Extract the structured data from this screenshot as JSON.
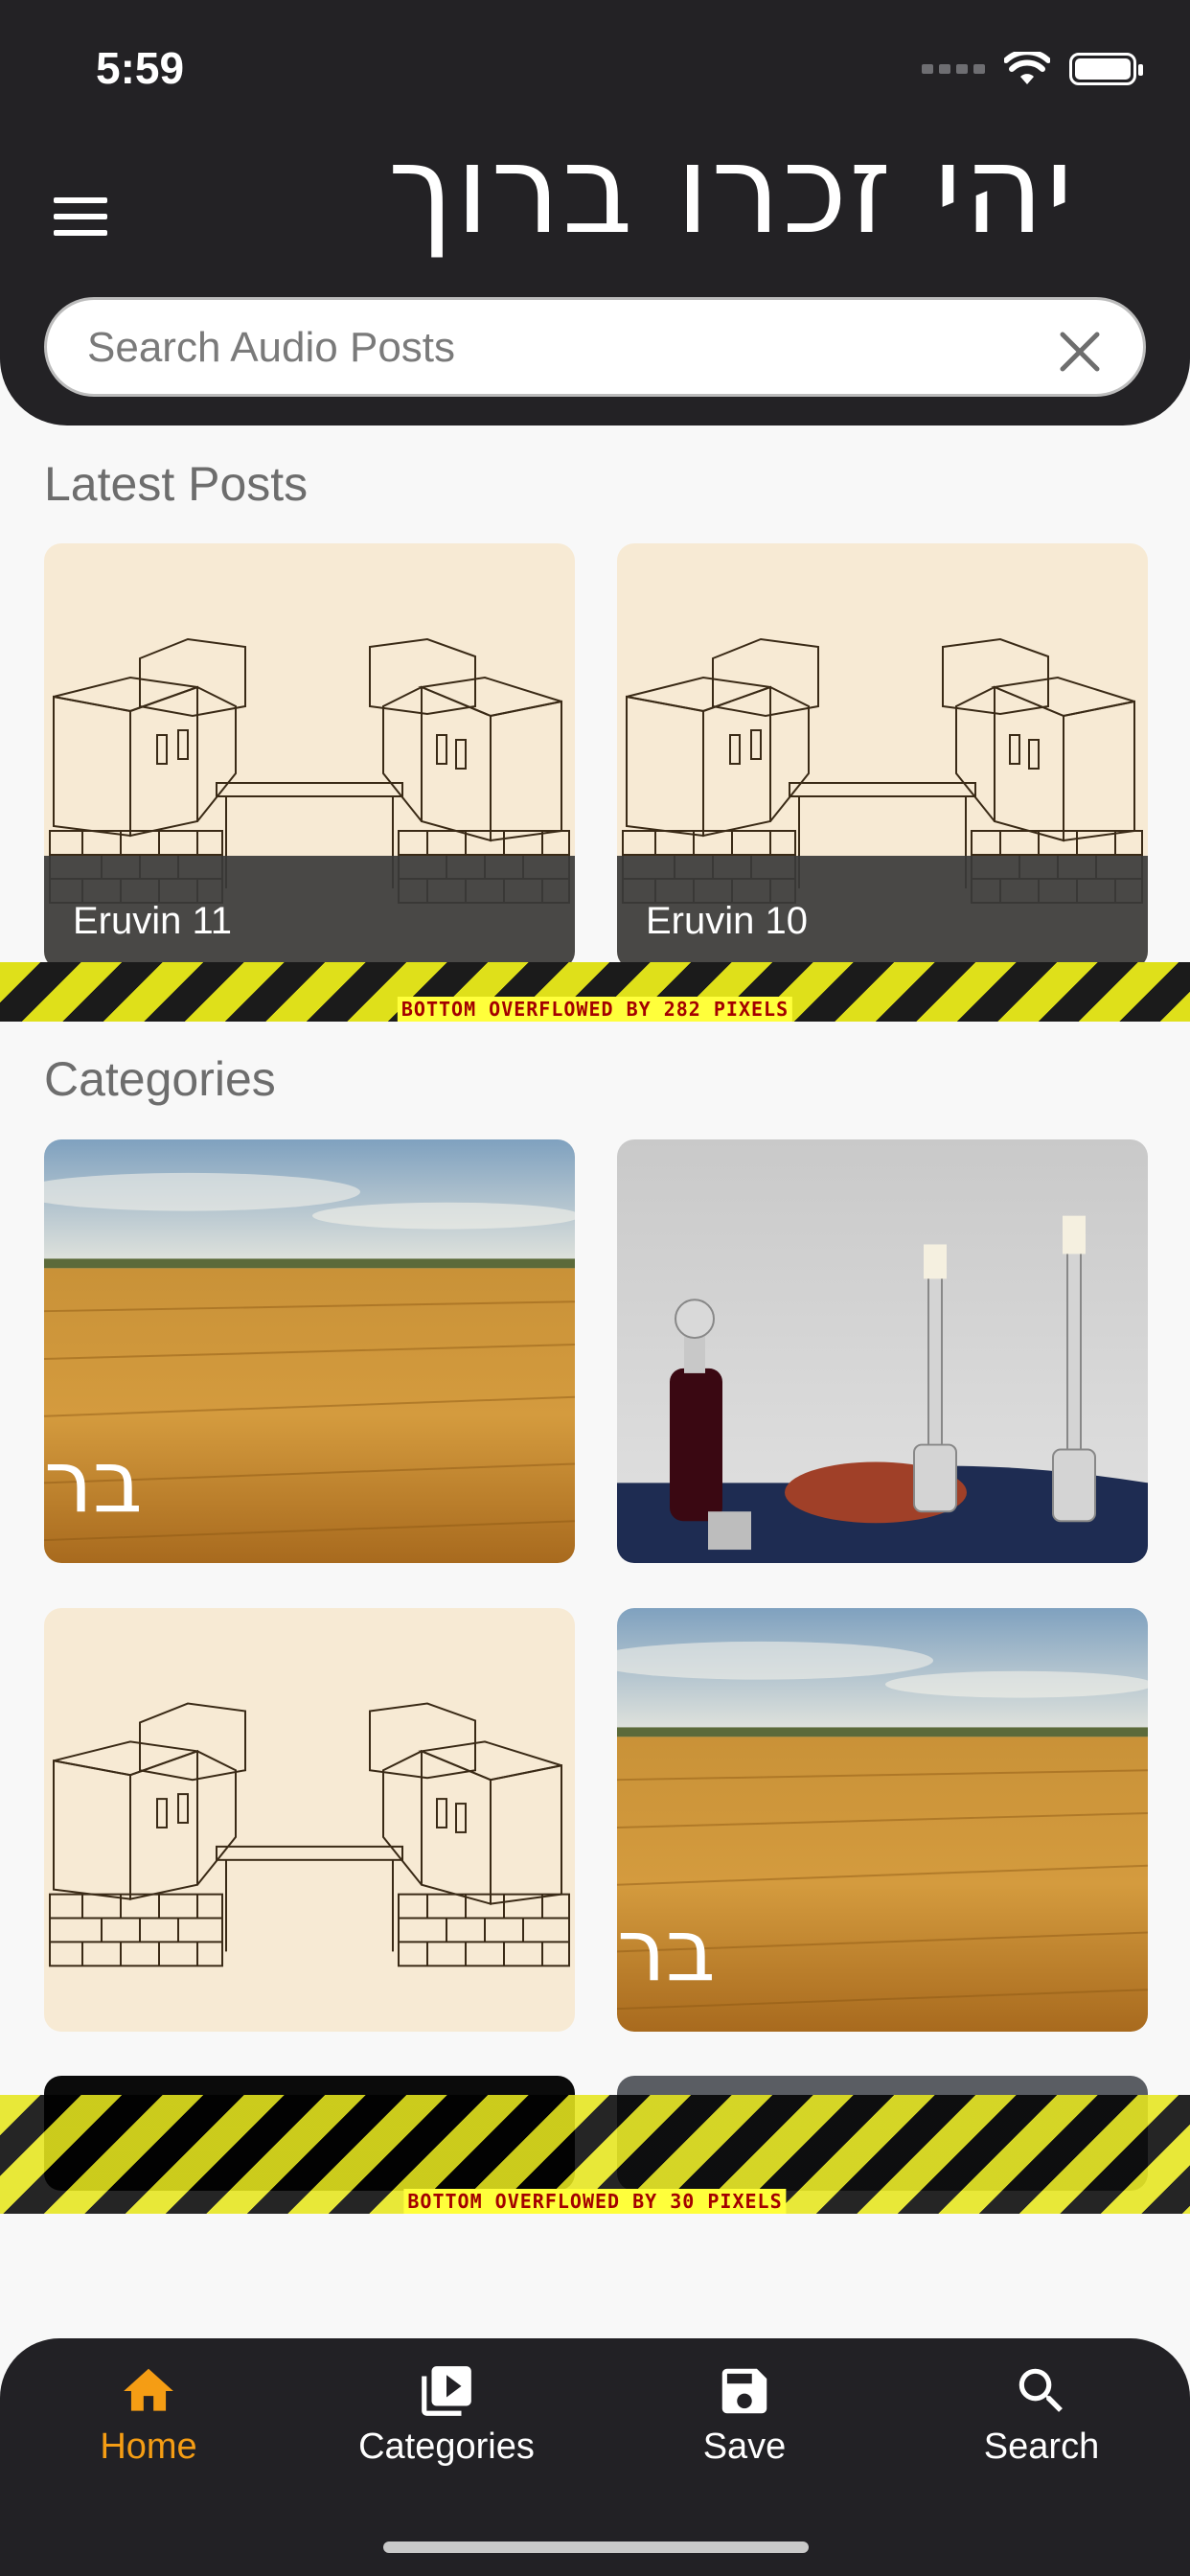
{
  "status_bar": {
    "time": "5:59"
  },
  "header": {
    "title": "יהי זכרו ברוך",
    "menu_icon": "hamburger-icon",
    "search": {
      "placeholder": "Search Audio Posts",
      "value": "",
      "clear_icon": "close-icon"
    }
  },
  "latest": {
    "heading": "Latest Posts",
    "posts": [
      {
        "title": "Eruvin 11",
        "image": "eruvin-illustration"
      },
      {
        "title": "Eruvin 10",
        "image": "eruvin-illustration"
      }
    ]
  },
  "overflow_warnings": [
    "BOTTOM OVERFLOWED BY 282 PIXELS",
    "BOTTOM OVERFLOWED BY 30 PIXELS"
  ],
  "categories": {
    "heading": "Categories",
    "items": [
      {
        "image": "wheat-field",
        "overlay_text": "בר"
      },
      {
        "image": "shabbat-candles"
      },
      {
        "image": "eruvin-illustration"
      },
      {
        "image": "wheat-field",
        "overlay_text": "בר"
      }
    ]
  },
  "bottom_nav": {
    "items": [
      {
        "label": "Home",
        "icon": "home-icon",
        "active": true
      },
      {
        "label": "Categories",
        "icon": "video-library-icon",
        "active": false
      },
      {
        "label": "Save",
        "icon": "save-icon",
        "active": false
      },
      {
        "label": "Search",
        "icon": "search-icon",
        "active": false
      }
    ]
  },
  "colors": {
    "header_bg": "#232225",
    "accent": "#f59d14",
    "card_bg": "#f7ead4",
    "page_bg": "#f8f8f8"
  }
}
